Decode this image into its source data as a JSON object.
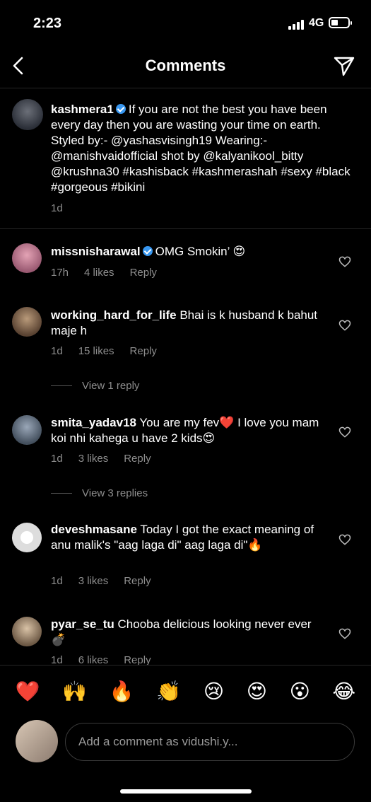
{
  "status": {
    "time": "2:23",
    "network": "4G"
  },
  "header": {
    "title": "Comments"
  },
  "caption": {
    "username": "kashmera1",
    "text": "If you are not the best you have been every day then you are wasting your time on earth. Styled by:- @yashasvisingh19 Wearing:- @manishvaidofficial shot by @kalyanikool_bitty  @krushna30 #kashisback #kashmerashah #sexy #black #gorgeous #bikini",
    "time": "1d"
  },
  "comments": [
    {
      "username": "missnisharawal",
      "verified": true,
      "text": "OMG Smokin’ 😍",
      "time": "17h",
      "likes": "4 likes",
      "reply": "Reply"
    },
    {
      "username": "working_hard_for_life",
      "text": "Bhai is k husband k bahut maje h",
      "time": "1d",
      "likes": "15 likes",
      "reply": "Reply",
      "view_replies": "View 1 reply"
    },
    {
      "username": "smita_yadav18",
      "text": "You are my fev❤️  I love you mam koi nhi kahega u have 2 kids😍",
      "time": "1d",
      "likes": "3 likes",
      "reply": "Reply",
      "view_replies": "View 3 replies"
    },
    {
      "username": "deveshmasane",
      "text": "Today I got the exact meaning of anu malik's \"aag laga di\" aag laga di\"🔥",
      "time": "1d",
      "likes": "3 likes",
      "reply": "Reply"
    },
    {
      "username": "pyar_se_tu",
      "text": "Chooba delicious looking never ever💣",
      "time": "1d",
      "likes": "6 likes",
      "reply": "Reply"
    }
  ],
  "reactions": [
    "❤️",
    "🙌",
    "🔥",
    "👏",
    "😢",
    "😍",
    "😮",
    "😂"
  ],
  "input": {
    "placeholder": "Add a comment as vidushi.y..."
  }
}
